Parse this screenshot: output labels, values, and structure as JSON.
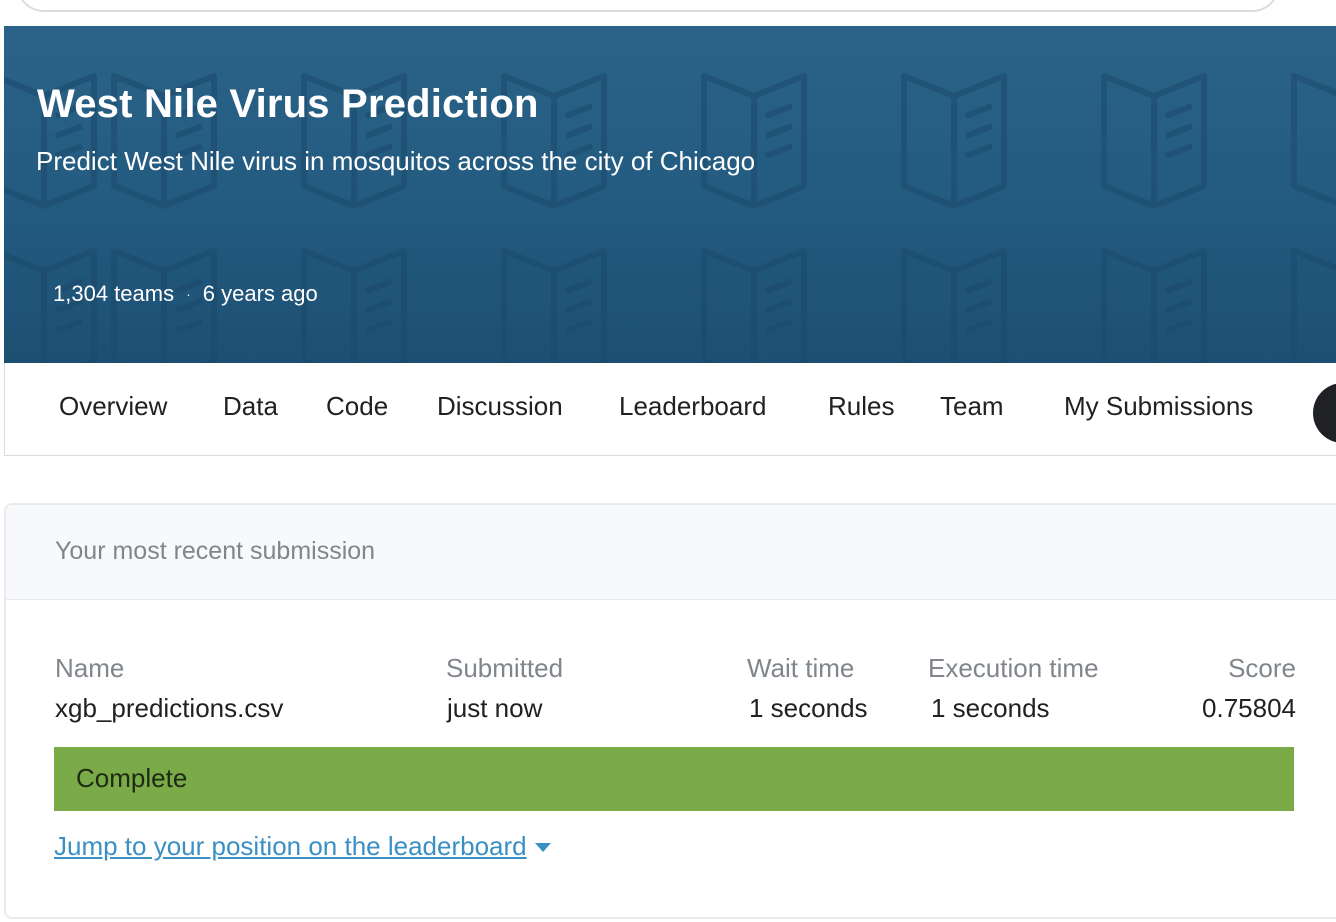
{
  "competition": {
    "title": "West Nile Virus Prediction",
    "subtitle": "Predict West Nile virus in mosquitos across the city of Chicago",
    "teams": "1,304 teams",
    "separator": "·",
    "age": "6 years ago",
    "banner_color": "#235a80"
  },
  "tabs": [
    {
      "label": "Overview"
    },
    {
      "label": "Data"
    },
    {
      "label": "Code"
    },
    {
      "label": "Discussion"
    },
    {
      "label": "Leaderboard"
    },
    {
      "label": "Rules"
    },
    {
      "label": "Team"
    },
    {
      "label": "My Submissions"
    }
  ],
  "submission": {
    "header": "Your most recent submission",
    "columns": {
      "name": "Name",
      "submitted": "Submitted",
      "wait_time": "Wait time",
      "execution_time": "Execution time",
      "score": "Score"
    },
    "values": {
      "name": "xgb_predictions.csv",
      "submitted": "just now",
      "wait_time": "1 seconds",
      "execution_time": "1 seconds",
      "score": "0.75804"
    },
    "status": "Complete",
    "status_color": "#7aab48",
    "jump_link": "Jump to your position on the leaderboard"
  },
  "icons": {
    "banner_pattern": "open-book-icon",
    "jump_caret": "caret-down-icon"
  }
}
